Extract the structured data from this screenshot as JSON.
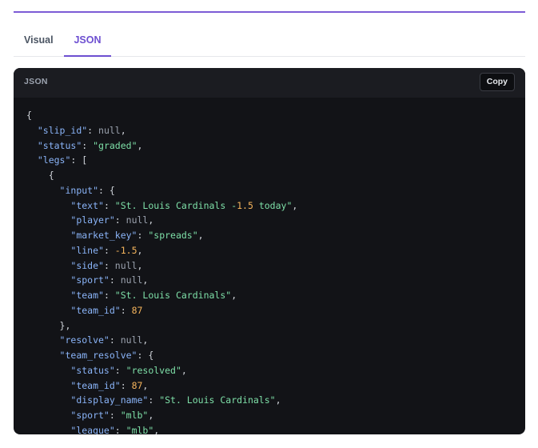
{
  "tabs": [
    {
      "label": "Visual",
      "active": false
    },
    {
      "label": "JSON",
      "active": true
    }
  ],
  "panel": {
    "title": "JSON",
    "copy_label": "Copy"
  },
  "colors": {
    "accent": "#6d4fd1",
    "panel_bg": "#121317",
    "key": "#8ab4f8",
    "string": "#7ee0a8",
    "number": "#f5b45c",
    "null": "#9ca3af"
  },
  "code_lines": [
    [
      [
        "p",
        "{"
      ]
    ],
    [
      [
        "p",
        "  "
      ],
      [
        "k",
        "\"slip_id\""
      ],
      [
        "p",
        ": "
      ],
      [
        "nl",
        "null"
      ],
      [
        "p",
        ","
      ]
    ],
    [
      [
        "p",
        "  "
      ],
      [
        "k",
        "\"status\""
      ],
      [
        "p",
        ": "
      ],
      [
        "s",
        "\"graded\""
      ],
      [
        "p",
        ","
      ]
    ],
    [
      [
        "p",
        "  "
      ],
      [
        "k",
        "\"legs\""
      ],
      [
        "p",
        ": ["
      ]
    ],
    [
      [
        "p",
        "    {"
      ]
    ],
    [
      [
        "p",
        "      "
      ],
      [
        "k",
        "\"input\""
      ],
      [
        "p",
        ": {"
      ]
    ],
    [
      [
        "p",
        "        "
      ],
      [
        "k",
        "\"text\""
      ],
      [
        "p",
        ": "
      ],
      [
        "s",
        "\"St. Louis Cardinals -"
      ],
      [
        "n",
        "1.5"
      ],
      [
        "s",
        " today\""
      ],
      [
        "p",
        ","
      ]
    ],
    [
      [
        "p",
        "        "
      ],
      [
        "k",
        "\"player\""
      ],
      [
        "p",
        ": "
      ],
      [
        "nl",
        "null"
      ],
      [
        "p",
        ","
      ]
    ],
    [
      [
        "p",
        "        "
      ],
      [
        "k",
        "\"market_key\""
      ],
      [
        "p",
        ": "
      ],
      [
        "s",
        "\"spreads\""
      ],
      [
        "p",
        ","
      ]
    ],
    [
      [
        "p",
        "        "
      ],
      [
        "k",
        "\"line\""
      ],
      [
        "p",
        ": "
      ],
      [
        "n",
        "-1.5"
      ],
      [
        "p",
        ","
      ]
    ],
    [
      [
        "p",
        "        "
      ],
      [
        "k",
        "\"side\""
      ],
      [
        "p",
        ": "
      ],
      [
        "nl",
        "null"
      ],
      [
        "p",
        ","
      ]
    ],
    [
      [
        "p",
        "        "
      ],
      [
        "k",
        "\"sport\""
      ],
      [
        "p",
        ": "
      ],
      [
        "nl",
        "null"
      ],
      [
        "p",
        ","
      ]
    ],
    [
      [
        "p",
        "        "
      ],
      [
        "k",
        "\"team\""
      ],
      [
        "p",
        ": "
      ],
      [
        "s",
        "\"St. Louis Cardinals\""
      ],
      [
        "p",
        ","
      ]
    ],
    [
      [
        "p",
        "        "
      ],
      [
        "k",
        "\"team_id\""
      ],
      [
        "p",
        ": "
      ],
      [
        "n",
        "87"
      ]
    ],
    [
      [
        "p",
        "      },"
      ]
    ],
    [
      [
        "p",
        "      "
      ],
      [
        "k",
        "\"resolve\""
      ],
      [
        "p",
        ": "
      ],
      [
        "nl",
        "null"
      ],
      [
        "p",
        ","
      ]
    ],
    [
      [
        "p",
        "      "
      ],
      [
        "k",
        "\"team_resolve\""
      ],
      [
        "p",
        ": {"
      ]
    ],
    [
      [
        "p",
        "        "
      ],
      [
        "k",
        "\"status\""
      ],
      [
        "p",
        ": "
      ],
      [
        "s",
        "\"resolved\""
      ],
      [
        "p",
        ","
      ]
    ],
    [
      [
        "p",
        "        "
      ],
      [
        "k",
        "\"team_id\""
      ],
      [
        "p",
        ": "
      ],
      [
        "n",
        "87"
      ],
      [
        "p",
        ","
      ]
    ],
    [
      [
        "p",
        "        "
      ],
      [
        "k",
        "\"display_name\""
      ],
      [
        "p",
        ": "
      ],
      [
        "s",
        "\"St. Louis Cardinals\""
      ],
      [
        "p",
        ","
      ]
    ],
    [
      [
        "p",
        "        "
      ],
      [
        "k",
        "\"sport\""
      ],
      [
        "p",
        ": "
      ],
      [
        "s",
        "\"mlb\""
      ],
      [
        "p",
        ","
      ]
    ],
    [
      [
        "p",
        "        "
      ],
      [
        "k",
        "\"league\""
      ],
      [
        "p",
        ": "
      ],
      [
        "s",
        "\"mlb\""
      ],
      [
        "p",
        ","
      ]
    ]
  ]
}
